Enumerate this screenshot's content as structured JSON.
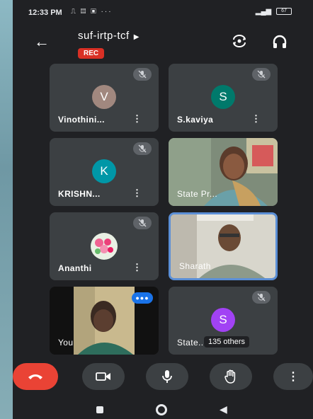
{
  "status_bar": {
    "time": "12:33 PM",
    "battery": "67"
  },
  "meeting": {
    "title": "suf-irtp-tcf",
    "rec_label": "REC"
  },
  "participants": [
    {
      "name": "Vinothini...",
      "initial": "V",
      "avatar_color": "#a1887f",
      "muted": true
    },
    {
      "name": "S.kaviya",
      "initial": "S",
      "avatar_color": "#00796b",
      "muted": true
    },
    {
      "name": "KRISHN...",
      "initial": "K",
      "avatar_color": "#0097a7",
      "muted": true
    },
    {
      "name": "State Pr...",
      "video": true
    },
    {
      "name": "Ananthi",
      "avatar_type": "flowers",
      "muted": true
    },
    {
      "name": "Sharath",
      "video": true,
      "selected": true
    },
    {
      "name": "You",
      "video": true
    },
    {
      "name": "State...",
      "initial": "S",
      "avatar_color": "#a142f4",
      "muted": true,
      "others_label": "135 others"
    }
  ],
  "controls": [
    "end-call",
    "camera",
    "microphone",
    "raise-hand",
    "more"
  ]
}
